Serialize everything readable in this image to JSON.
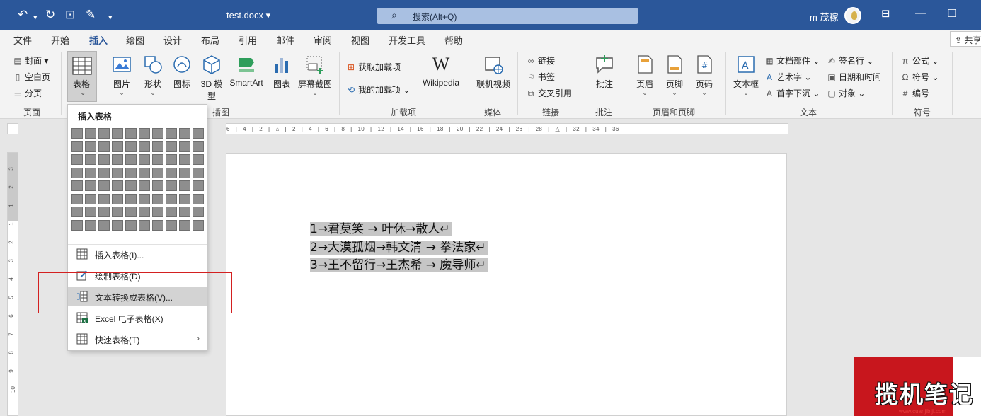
{
  "title_bar": {
    "doc_title": "test.docx ▾",
    "search_placeholder": "搜索(Alt+Q)",
    "user_name": "m 茂稼",
    "icons": [
      "undo-icon",
      "redo-icon",
      "touch-mode-icon",
      "edit-icon",
      "customize-qat-icon"
    ]
  },
  "menu_tabs": [
    "文件",
    "开始",
    "插入",
    "绘图",
    "设计",
    "布局",
    "引用",
    "邮件",
    "审阅",
    "视图",
    "开发工具",
    "帮助"
  ],
  "active_tab": "插入",
  "share_label": "共享",
  "ribbon": {
    "pages_group": {
      "items": [
        "封面",
        "空白页",
        "分页"
      ],
      "label": "页面"
    },
    "table_button": {
      "label": "表格"
    },
    "illustrations": {
      "items": [
        "图片",
        "形状",
        "图标",
        "3D 模型",
        "SmartArt",
        "图表",
        "屏幕截图"
      ],
      "label": "插图"
    },
    "addins": {
      "items": [
        "获取加载项",
        "我的加载项"
      ],
      "wikipedia": "Wikipedia",
      "label": "加载项"
    },
    "media": {
      "item": "联机视频",
      "label": "媒体"
    },
    "links": {
      "items": [
        "链接",
        "书签",
        "交叉引用"
      ],
      "label": "链接"
    },
    "comments": {
      "item": "批注",
      "label": "批注"
    },
    "header_footer": {
      "items": [
        "页眉",
        "页脚",
        "页码"
      ],
      "label": "页眉和页脚"
    },
    "text": {
      "textbox": "文本框",
      "items": [
        "文档部件",
        "艺术字",
        "首字下沉",
        "签名行",
        "日期和时间",
        "对象"
      ],
      "label": "文本"
    },
    "symbols": {
      "items": [
        "公式",
        "符号",
        "编号"
      ],
      "label": "符号"
    }
  },
  "dropdown": {
    "header": "插入表格",
    "grid": {
      "cols": 10,
      "rows": 8
    },
    "items": [
      "插入表格(I)...",
      "绘制表格(D)",
      "文本转换成表格(V)...",
      "Excel 电子表格(X)",
      "快速表格(T)"
    ],
    "highlighted_index": 2
  },
  "ruler": {
    "horizontal": "6 · | · 4 · | · 2 · | · ⌂ · | · 2 · | · 4 · | · 6 · | · 8 · | · 10 · | · 12 · | · 14 · | · 16 · | · 18 · | · 20 · | · 22 · | · 24 · | · 26 · | · 28 · | · △ · | · 32 · | · 34 · | · 36",
    "vertical_numbers": [
      "3",
      "2",
      "1",
      "1",
      "2",
      "3",
      "4",
      "5",
      "6",
      "7",
      "8",
      "9",
      "10"
    ]
  },
  "document": {
    "lines": [
      "1→君莫笑 → 叶休→散人↵",
      "2→大漠孤烟→韩文清 → 拳法家↵",
      "3→王不留行→王杰希 → 魔导师↵"
    ]
  },
  "watermark": {
    "text": "揽机笔记",
    "url": "www.cuanjibiji.com"
  },
  "colors": {
    "title_bar": "#2b579a",
    "highlight_box": "#d32020",
    "selection": "#c6c6c6"
  }
}
